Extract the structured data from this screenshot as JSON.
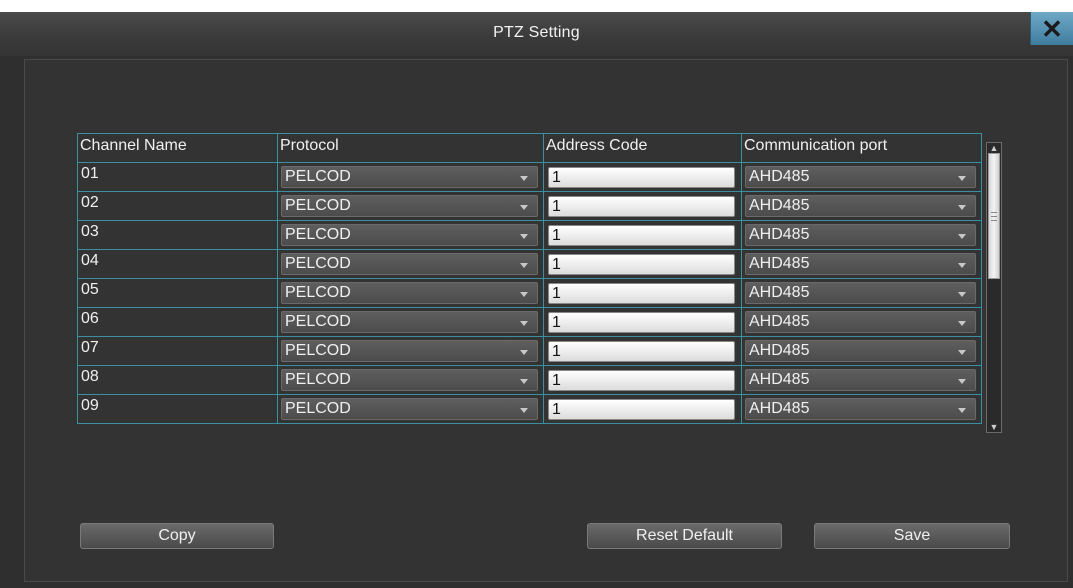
{
  "window": {
    "title": "PTZ Setting"
  },
  "table": {
    "headers": [
      "Channel Name",
      "Protocol",
      "Address Code",
      "Communication port"
    ],
    "rows": [
      {
        "channel": "01",
        "protocol": "PELCOD",
        "address": "1",
        "port": "AHD485"
      },
      {
        "channel": "02",
        "protocol": "PELCOD",
        "address": "1",
        "port": "AHD485"
      },
      {
        "channel": "03",
        "protocol": "PELCOD",
        "address": "1",
        "port": "AHD485"
      },
      {
        "channel": "04",
        "protocol": "PELCOD",
        "address": "1",
        "port": "AHD485"
      },
      {
        "channel": "05",
        "protocol": "PELCOD",
        "address": "1",
        "port": "AHD485"
      },
      {
        "channel": "06",
        "protocol": "PELCOD",
        "address": "1",
        "port": "AHD485"
      },
      {
        "channel": "07",
        "protocol": "PELCOD",
        "address": "1",
        "port": "AHD485"
      },
      {
        "channel": "08",
        "protocol": "PELCOD",
        "address": "1",
        "port": "AHD485"
      },
      {
        "channel": "09",
        "protocol": "PELCOD",
        "address": "1",
        "port": "AHD485"
      }
    ]
  },
  "buttons": {
    "copy": "Copy",
    "reset": "Reset Default",
    "save": "Save"
  },
  "icons": {
    "close": "close-icon",
    "dropdown": "chevron-down-icon"
  },
  "colors": {
    "grid": "#3a8fa3",
    "close_button": "#5b97b8",
    "background": "#2f2f2f"
  }
}
